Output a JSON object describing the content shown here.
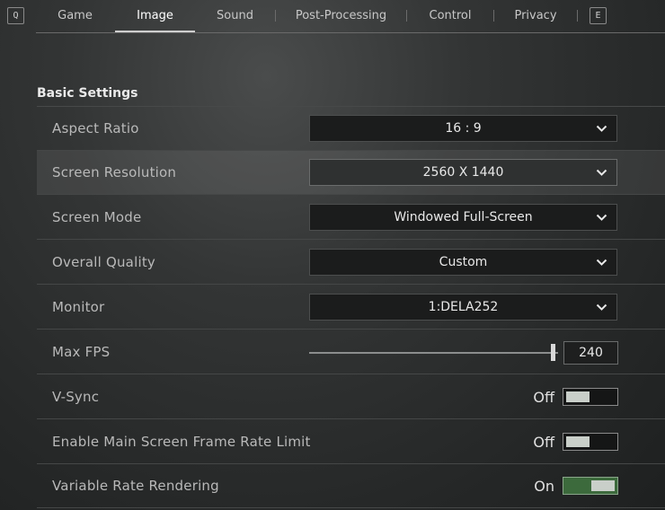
{
  "nav": {
    "left_key": "Q",
    "right_key": "E",
    "tabs": [
      {
        "label": "Game",
        "active": false
      },
      {
        "label": "Image",
        "active": true
      },
      {
        "label": "Sound",
        "active": false
      },
      {
        "label": "Post-Processing",
        "active": false
      },
      {
        "label": "Control",
        "active": false
      },
      {
        "label": "Privacy",
        "active": false
      }
    ]
  },
  "section": {
    "title": "Basic Settings"
  },
  "settings": {
    "aspect_ratio": {
      "label": "Aspect Ratio",
      "value": "16 : 9"
    },
    "screen_resolution": {
      "label": "Screen Resolution",
      "value": "2560 X 1440"
    },
    "screen_mode": {
      "label": "Screen Mode",
      "value": "Windowed Full-Screen"
    },
    "overall_quality": {
      "label": "Overall Quality",
      "value": "Custom"
    },
    "monitor": {
      "label": "Monitor",
      "value": "1:DELA252"
    },
    "max_fps": {
      "label": "Max FPS",
      "value": "240",
      "slider_fraction": 0.99
    },
    "vsync": {
      "label": "V-Sync",
      "state": "Off"
    },
    "frame_rate_limit": {
      "label": "Enable Main Screen Frame Rate Limit",
      "state": "Off"
    },
    "variable_rate_rendering": {
      "label": "Variable Rate Rendering",
      "state": "On"
    }
  },
  "colors": {
    "toggle_on": "#3c6a3c",
    "active_tab_underline": "#cfcfcf"
  },
  "icons": {
    "dropdown": "chevron-down-icon"
  }
}
